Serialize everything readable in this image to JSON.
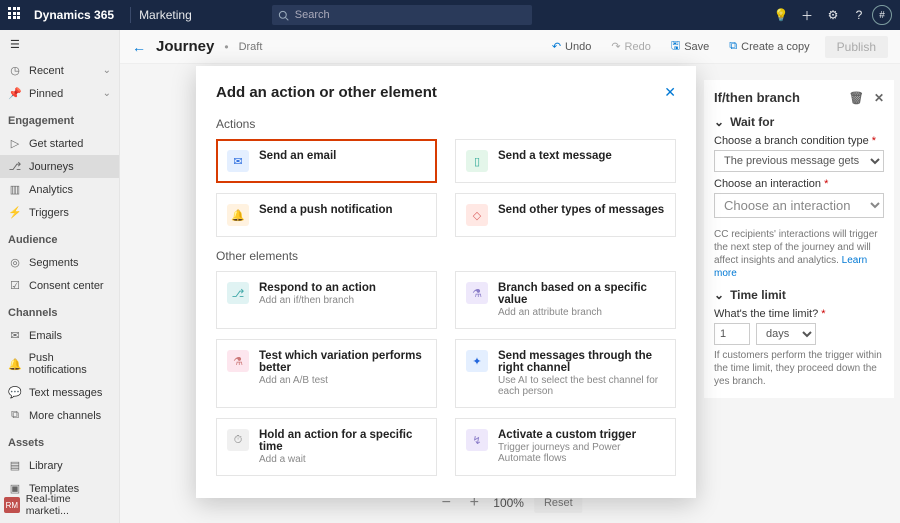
{
  "topbar": {
    "app": "Dynamics 365",
    "area": "Marketing",
    "search_placeholder": "Search",
    "avatar_initial": "#"
  },
  "sidebar": {
    "recent": "Recent",
    "pinned": "Pinned",
    "engagement": "Engagement",
    "get_started": "Get started",
    "journeys": "Journeys",
    "analytics": "Analytics",
    "triggers": "Triggers",
    "audience": "Audience",
    "segments": "Segments",
    "consent": "Consent center",
    "channels": "Channels",
    "emails": "Emails",
    "push": "Push notifications",
    "text": "Text messages",
    "more": "More channels",
    "assets": "Assets",
    "library": "Library",
    "templates": "Templates",
    "footer_badge": "RM",
    "footer_label": "Real-time marketi..."
  },
  "header": {
    "title": "Journey",
    "status": "Draft",
    "undo": "Undo",
    "redo": "Redo",
    "save": "Save",
    "copy": "Create a copy",
    "publish": "Publish"
  },
  "zoom": {
    "pct": "100%",
    "reset": "Reset"
  },
  "rpanel": {
    "title": "If/then branch",
    "waitfor": "Wait for",
    "cond_label": "Choose a branch condition type",
    "cond_value": "The previous message gets an interacti...",
    "inter_label": "Choose an interaction",
    "inter_placeholder": "Choose an interaction",
    "help1": "CC recipients' interactions will trigger the next step of the journey and will affect insights and analytics.",
    "learn": "Learn more",
    "timelimit": "Time limit",
    "tl_label": "What's the time limit?",
    "tl_num": "1",
    "tl_unit": "days",
    "help2": "If customers perform the trigger within the time limit, they proceed down the yes branch."
  },
  "modal": {
    "title": "Add an action or other element",
    "actions_h": "Actions",
    "other_h": "Other elements",
    "actions": {
      "email": "Send an email",
      "text": "Send a text message",
      "push": "Send a push notification",
      "other": "Send other types of messages"
    },
    "elements": {
      "respond_t": "Respond to an action",
      "respond_s": "Add an if/then branch",
      "branch_t": "Branch based on a specific value",
      "branch_s": "Add an attribute branch",
      "test_t": "Test which variation performs better",
      "test_s": "Add an A/B test",
      "channel_t": "Send messages through the right channel",
      "channel_s": "Use AI to select the best channel for each person",
      "hold_t": "Hold an action for a specific time",
      "hold_s": "Add a wait",
      "trigger_t": "Activate a custom trigger",
      "trigger_s": "Trigger journeys and Power Automate flows"
    }
  }
}
